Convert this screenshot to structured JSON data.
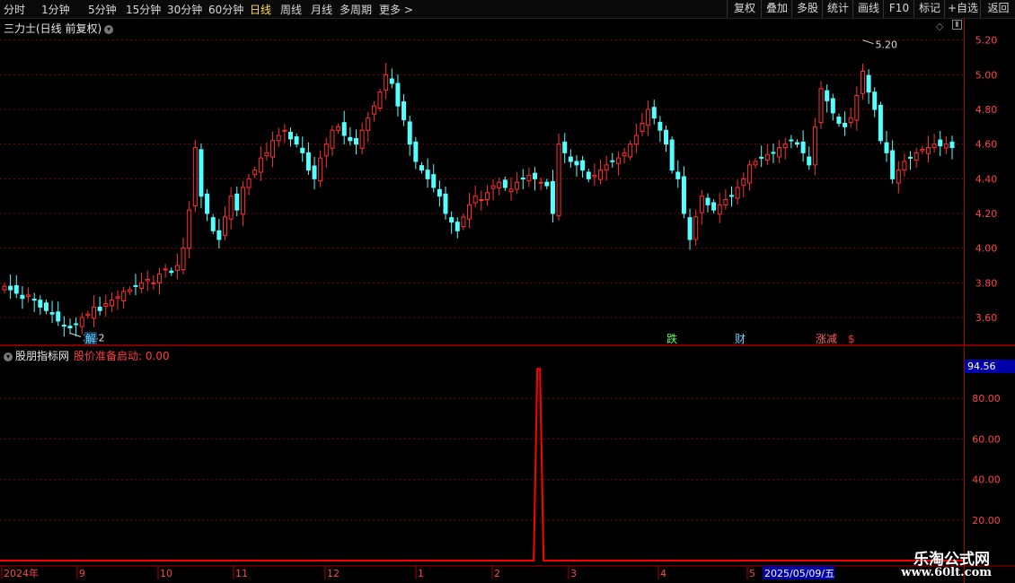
{
  "toolbar": {
    "periods": [
      "分时",
      "1分钟",
      "5分钟",
      "15分钟",
      "30分钟",
      "60分钟",
      "日线",
      "周线",
      "月线",
      "多周期",
      "更多 >"
    ],
    "active_period": "日线",
    "tools": [
      "复权",
      "叠加",
      "多股",
      "统计",
      "画线",
      "F10",
      "+自选",
      "返回"
    ]
  },
  "stock": {
    "title": "三力士(日线 前复权)",
    "high_label": "5.20",
    "low_label": "3.52"
  },
  "price_axis": {
    "ticks": [
      "5.20",
      "5.00",
      "4.80",
      "4.60",
      "4.40",
      "4.20",
      "4.00",
      "3.80",
      "3.60"
    ]
  },
  "event_markers": [
    {
      "text": "解",
      "color": "#6ad7ff",
      "bg": "#1a3a5a"
    },
    {
      "text": "跌",
      "color": "#60ff60",
      "bg": ""
    },
    {
      "text": "财",
      "color": "#6ad7ff",
      "bg": ""
    },
    {
      "text": "涨减",
      "color": "#ff6060",
      "bg": ""
    },
    {
      "text": "$",
      "color": "#ff3030",
      "bg": ""
    }
  ],
  "indicator": {
    "name": "股朋指标网",
    "field_label": "股价准备启动:",
    "field_value": "0.00",
    "current_value": "94.56",
    "ticks": [
      "80.00",
      "60.00",
      "40.00",
      "20.00"
    ]
  },
  "time_axis": {
    "labels": [
      "2024年",
      "9",
      "10",
      "11",
      "12",
      "1",
      "2",
      "3",
      "4",
      "5"
    ],
    "cursor_date": "2025/05/09/五"
  },
  "watermark": {
    "line1": "乐淘公式网",
    "line2": "www.60lt.com"
  },
  "colors": {
    "up": "#ff3030",
    "down": "#54ffff",
    "grid": "#7a0000",
    "axis": "#aa0000",
    "signal": "#ff0000"
  },
  "chart_data": {
    "type": "candlestick",
    "ylim": [
      3.45,
      5.25
    ],
    "indicator_ylim": [
      0,
      100
    ],
    "close_series": [
      3.78,
      3.76,
      3.74,
      3.71,
      3.73,
      3.7,
      3.66,
      3.64,
      3.62,
      3.58,
      3.55,
      3.54,
      3.56,
      3.6,
      3.62,
      3.66,
      3.64,
      3.68,
      3.7,
      3.72,
      3.75,
      3.76,
      3.78,
      3.8,
      3.82,
      3.8,
      3.85,
      3.88,
      3.86,
      3.9,
      4.0,
      4.22,
      4.58,
      4.3,
      4.2,
      4.1,
      4.05,
      4.18,
      4.3,
      4.22,
      4.35,
      4.4,
      4.45,
      4.52,
      4.55,
      4.62,
      4.65,
      4.68,
      4.63,
      4.6,
      4.55,
      4.45,
      4.4,
      4.52,
      4.6,
      4.68,
      4.7,
      4.65,
      4.62,
      4.6,
      4.68,
      4.75,
      4.82,
      4.9,
      5.0,
      4.95,
      4.82,
      4.74,
      4.6,
      4.5,
      4.45,
      4.4,
      4.35,
      4.3,
      4.2,
      4.15,
      4.1,
      4.18,
      4.25,
      4.3,
      4.28,
      4.32,
      4.36,
      4.38,
      4.35,
      4.34,
      4.38,
      4.4,
      4.42,
      4.4,
      4.38,
      4.36,
      4.2,
      4.6,
      4.55,
      4.5,
      4.48,
      4.45,
      4.4,
      4.42,
      4.45,
      4.48,
      4.5,
      4.52,
      4.55,
      4.6,
      4.65,
      4.72,
      4.8,
      4.75,
      4.68,
      4.6,
      4.45,
      4.4,
      4.2,
      4.05,
      4.18,
      4.3,
      4.25,
      4.22,
      4.25,
      4.28,
      4.3,
      4.35,
      4.4,
      4.48,
      4.5,
      4.52,
      4.54,
      4.55,
      4.58,
      4.6,
      4.62,
      4.6,
      4.55,
      4.48,
      4.7,
      4.92,
      4.85,
      4.78,
      4.72,
      4.7,
      4.75,
      4.88,
      5.02,
      4.9,
      4.8,
      4.62,
      4.55,
      4.4,
      4.45,
      4.5,
      4.52,
      4.55,
      4.57,
      4.58,
      4.6,
      4.59,
      4.6,
      4.58
    ],
    "indicator_signal": {
      "index": 90,
      "value": 94.56
    }
  }
}
